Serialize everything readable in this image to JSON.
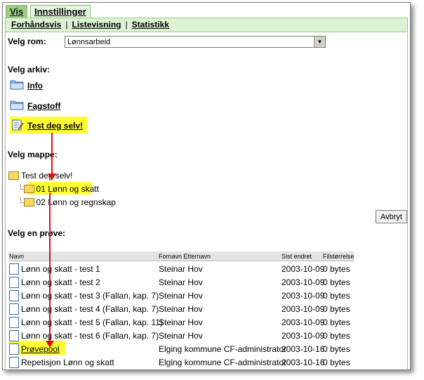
{
  "tabs": [
    {
      "label": "Vis",
      "active": true
    },
    {
      "label": "Innstillinger",
      "active": false
    }
  ],
  "subnav": [
    "Forhåndsvis",
    "Listevisning",
    "Statistikk"
  ],
  "rom": {
    "label": "Velg rom:",
    "value": "Lønnsarbeid"
  },
  "arkiv": {
    "label": "Velg arkiv:",
    "items": [
      "Info",
      "Fagstoff",
      "Test deg selv!"
    ]
  },
  "mappe": {
    "label": "Velg mappe:",
    "root": "Test deg selv!",
    "children": [
      "01 Lønn og skatt",
      "02 Lønn og regnskap"
    ]
  },
  "cancel_label": "Avbryt",
  "prove": {
    "label": "Velg en prøve:",
    "columns": [
      "Navn",
      "Fornavn Etternavn",
      "Sist endret",
      "Filstørrelse"
    ],
    "rows": [
      [
        "Lønn og skatt - test 1",
        "Steinar Hov",
        "2003-10-09",
        "0 bytes"
      ],
      [
        "Lønn og skatt - test 2",
        "Steinar Hov",
        "2003-10-09",
        "0 bytes"
      ],
      [
        "Lønn og skatt - test 3 (Fallan, kap. 7)",
        "Steinar Hov",
        "2003-10-09",
        "0 bytes"
      ],
      [
        "Lønn og skatt - test 4 (Fallan, kap. 7)",
        "Steinar Hov",
        "2003-10-09",
        "0 bytes"
      ],
      [
        "Lønn og skatt - test 5 (Fallan, kap. 11)",
        "Steinar Hov",
        "2003-10-09",
        "0 bytes"
      ],
      [
        "Lønn og skatt - test 6 (Fallan, kap. 7)",
        "Steinar Hov",
        "2003-10-09",
        "0 bytes"
      ],
      [
        "Prøvepool",
        "Elging kommune CF-administrator",
        "2003-10-16",
        "0 bytes"
      ],
      [
        "Repetisjon Lønn og skatt",
        "Elging kommune CF-administrator",
        "2003-10-16",
        "0 bytes"
      ]
    ]
  },
  "colors": {
    "tab_active": "#9ccc85",
    "highlight": "#ffff33",
    "arrow": "#e01010"
  }
}
